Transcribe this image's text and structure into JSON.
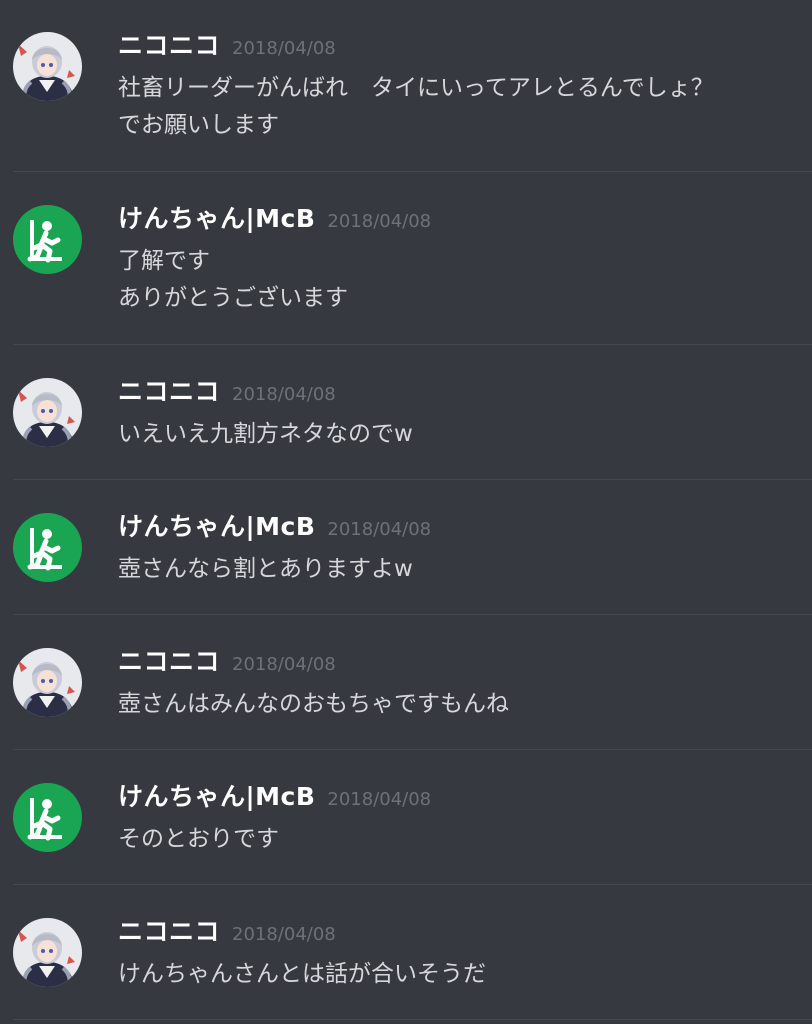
{
  "users": {
    "nico": {
      "name": "ニコニコ",
      "avatar_icon": "anime-girl-avatar"
    },
    "ken": {
      "name": "けんちゃん|McB",
      "avatar_icon": "emergency-exit-avatar",
      "color": "#1aa552"
    }
  },
  "messages": [
    {
      "author": "ニコニコ",
      "timestamp": "2018/04/08",
      "lines": [
        "社畜リーダーがんばれ　タイにいってアレとるんでしょ？",
        "でお願いします"
      ]
    },
    {
      "author": "けんちゃん|McB",
      "timestamp": "2018/04/08",
      "lines": [
        "了解です",
        "ありがとうございます"
      ]
    },
    {
      "author": "ニコニコ",
      "timestamp": "2018/04/08",
      "lines": [
        "いえいえ九割方ネタなのでw"
      ]
    },
    {
      "author": "けんちゃん|McB",
      "timestamp": "2018/04/08",
      "lines": [
        "壺さんなら割とありますよw"
      ]
    },
    {
      "author": "ニコニコ",
      "timestamp": "2018/04/08",
      "lines": [
        "壺さんはみんなのおもちゃですもんね"
      ]
    },
    {
      "author": "けんちゃん|McB",
      "timestamp": "2018/04/08",
      "lines": [
        "そのとおりです"
      ]
    },
    {
      "author": "ニコニコ",
      "timestamp": "2018/04/08",
      "lines": [
        "けんちゃんさんとは話が合いそうだ"
      ]
    }
  ]
}
